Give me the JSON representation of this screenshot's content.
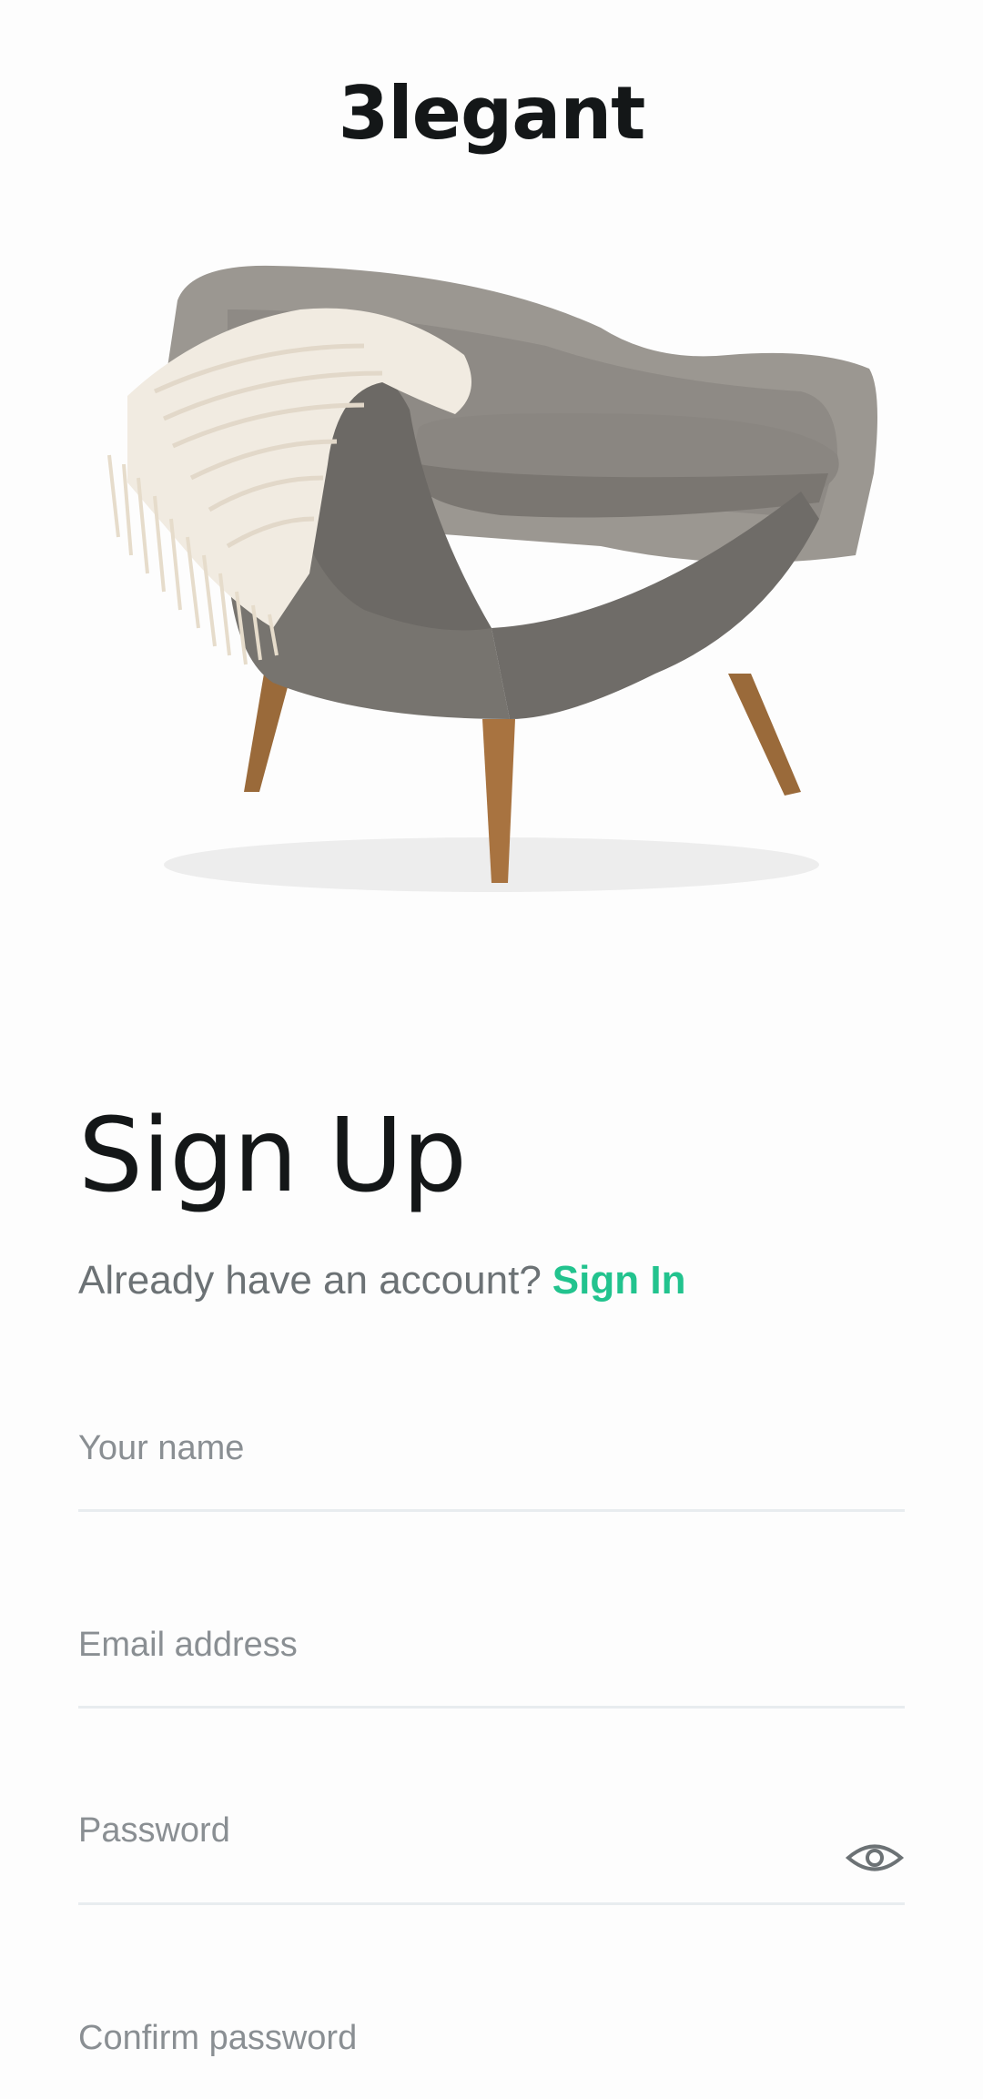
{
  "brand": {
    "name": "3legant"
  },
  "hero": {
    "image": "armchair-with-knitted-throw"
  },
  "heading": {
    "title": "Sign Up"
  },
  "account": {
    "prompt": "Already have an account?",
    "link_label": "Sign In"
  },
  "form": {
    "name": {
      "placeholder": "Your name",
      "value": ""
    },
    "email": {
      "placeholder": "Email address",
      "value": ""
    },
    "password": {
      "placeholder": "Password",
      "value": "",
      "toggle_icon": "eye-icon"
    },
    "confirm_password": {
      "placeholder": "Confirm password",
      "value": ""
    }
  },
  "colors": {
    "accent": "#22C38E",
    "text": "#141718",
    "muted": "#6C7275",
    "divider": "#E8ECEF"
  }
}
